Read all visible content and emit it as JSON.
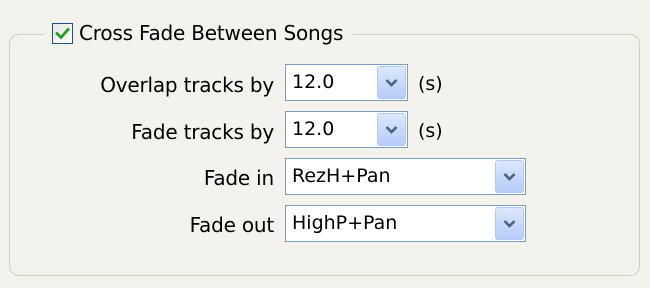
{
  "crossfade": {
    "label": "Cross Fade Between Songs",
    "checked": true
  },
  "rows": {
    "overlap": {
      "label": "Overlap tracks by",
      "value": "12.0",
      "unit": "(s)"
    },
    "fade": {
      "label": "Fade tracks by",
      "value": "12.0",
      "unit": "(s)"
    },
    "fade_in": {
      "label": "Fade in",
      "value": "RezH+Pan"
    },
    "fade_out": {
      "label": "Fade out",
      "value": "HighP+Pan"
    }
  },
  "icons": {
    "checkmark": "check-icon",
    "dropdown": "chevron-down-icon"
  },
  "colors": {
    "checkmark": "#21a121",
    "dropdown_arrow": "#4d6185",
    "field_border": "#7f9db9",
    "background": "#f3f2ec"
  }
}
